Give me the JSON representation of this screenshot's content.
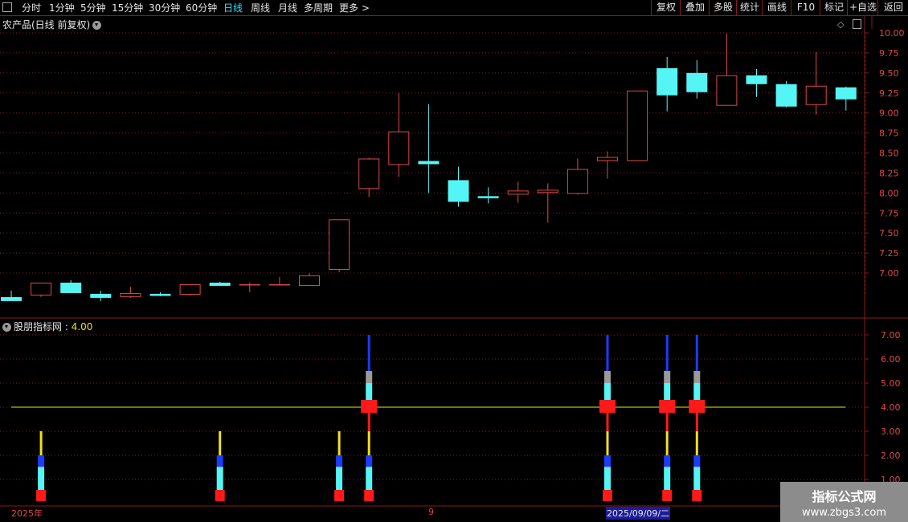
{
  "toolbar": {
    "left_items": [
      "分时",
      "1分钟",
      "5分钟",
      "15分钟",
      "30分钟",
      "60分钟",
      "日线",
      "周线",
      "月线",
      "多周期",
      "更多 >"
    ],
    "active": "日线",
    "right_items": [
      "复权",
      "叠加",
      "多股",
      "统计",
      "画线",
      "F10",
      "+自选",
      "标记",
      "返回"
    ]
  },
  "chart_title": "农产品(日线 前复权)",
  "indicator": {
    "name": "股朋指标网",
    "sep": " : ",
    "value": "4.00"
  },
  "dates": {
    "left": "2025年",
    "mid": "9",
    "selected": "2025/09/09/二"
  },
  "logo": {
    "line1": "指标公式网",
    "line2": "www.zbgs3.com"
  },
  "colors": {
    "up": "#e04848",
    "down": "#55f5f5",
    "grid": "#8b1a1a",
    "ref_line": "#e8e820"
  },
  "price_axis_labels": [
    "10.00",
    "9.75",
    "9.50",
    "9.25",
    "9.00",
    "8.75",
    "8.50",
    "8.25",
    "8.00",
    "7.75",
    "7.50",
    "7.25",
    "7.00"
  ],
  "ind_axis_labels": [
    "7.00",
    "6.00",
    "5.00",
    "4.00",
    "3.00",
    "2.00",
    "1.00"
  ],
  "chart_data": {
    "type": "candlestick",
    "ylim": [
      6.6,
      10.05
    ],
    "candles": [
      {
        "o": 6.7,
        "h": 6.78,
        "l": 6.65,
        "c": 6.66
      },
      {
        "o": 6.72,
        "h": 6.88,
        "l": 6.7,
        "c": 6.88
      },
      {
        "o": 6.88,
        "h": 6.91,
        "l": 6.76,
        "c": 6.76
      },
      {
        "o": 6.74,
        "h": 6.78,
        "l": 6.65,
        "c": 6.7
      },
      {
        "o": 6.7,
        "h": 6.83,
        "l": 6.69,
        "c": 6.75
      },
      {
        "o": 6.74,
        "h": 6.76,
        "l": 6.71,
        "c": 6.73
      },
      {
        "o": 6.73,
        "h": 6.86,
        "l": 6.72,
        "c": 6.86
      },
      {
        "o": 6.88,
        "h": 6.89,
        "l": 6.84,
        "c": 6.85
      },
      {
        "o": 6.86,
        "h": 6.88,
        "l": 6.76,
        "c": 6.86
      },
      {
        "o": 6.85,
        "h": 6.95,
        "l": 6.85,
        "c": 6.86
      },
      {
        "o": 6.84,
        "h": 7.0,
        "l": 6.84,
        "c": 6.97
      },
      {
        "o": 7.04,
        "h": 7.67,
        "l": 7.01,
        "c": 7.67
      },
      {
        "o": 8.05,
        "h": 8.44,
        "l": 7.95,
        "c": 8.43
      },
      {
        "o": 8.35,
        "h": 9.25,
        "l": 8.2,
        "c": 8.77
      },
      {
        "o": 8.4,
        "h": 9.11,
        "l": 8.0,
        "c": 8.37
      },
      {
        "o": 8.16,
        "h": 8.33,
        "l": 7.83,
        "c": 7.9
      },
      {
        "o": 7.96,
        "h": 8.07,
        "l": 7.87,
        "c": 7.95
      },
      {
        "o": 7.98,
        "h": 8.14,
        "l": 7.88,
        "c": 8.03
      },
      {
        "o": 8.0,
        "h": 8.12,
        "l": 7.63,
        "c": 8.04
      },
      {
        "o": 7.99,
        "h": 8.43,
        "l": 7.98,
        "c": 8.3
      },
      {
        "o": 8.4,
        "h": 8.52,
        "l": 8.18,
        "c": 8.45
      },
      {
        "o": 8.4,
        "h": 9.28,
        "l": 8.4,
        "c": 9.28
      },
      {
        "o": 9.56,
        "h": 9.7,
        "l": 9.02,
        "c": 9.23
      },
      {
        "o": 9.5,
        "h": 9.66,
        "l": 9.18,
        "c": 9.27
      },
      {
        "o": 9.09,
        "h": 9.99,
        "l": 9.09,
        "c": 9.47
      },
      {
        "o": 9.47,
        "h": 9.55,
        "l": 9.2,
        "c": 9.37
      },
      {
        "o": 9.36,
        "h": 9.4,
        "l": 9.07,
        "c": 9.09
      },
      {
        "o": 9.1,
        "h": 9.76,
        "l": 8.98,
        "c": 9.34
      },
      {
        "o": 9.32,
        "h": 9.33,
        "l": 9.03,
        "c": 9.18
      }
    ],
    "indicator": {
      "ylim": [
        0.6,
        7.4
      ],
      "reference": 4.0,
      "signals": [
        {
          "index": 1,
          "level": 3
        },
        {
          "index": 7,
          "level": 3
        },
        {
          "index": 11,
          "level": 3
        },
        {
          "index": 12,
          "level": 7
        },
        {
          "index": 20,
          "level": 7
        },
        {
          "index": 22,
          "level": 7
        },
        {
          "index": 23,
          "level": 7
        }
      ]
    }
  }
}
